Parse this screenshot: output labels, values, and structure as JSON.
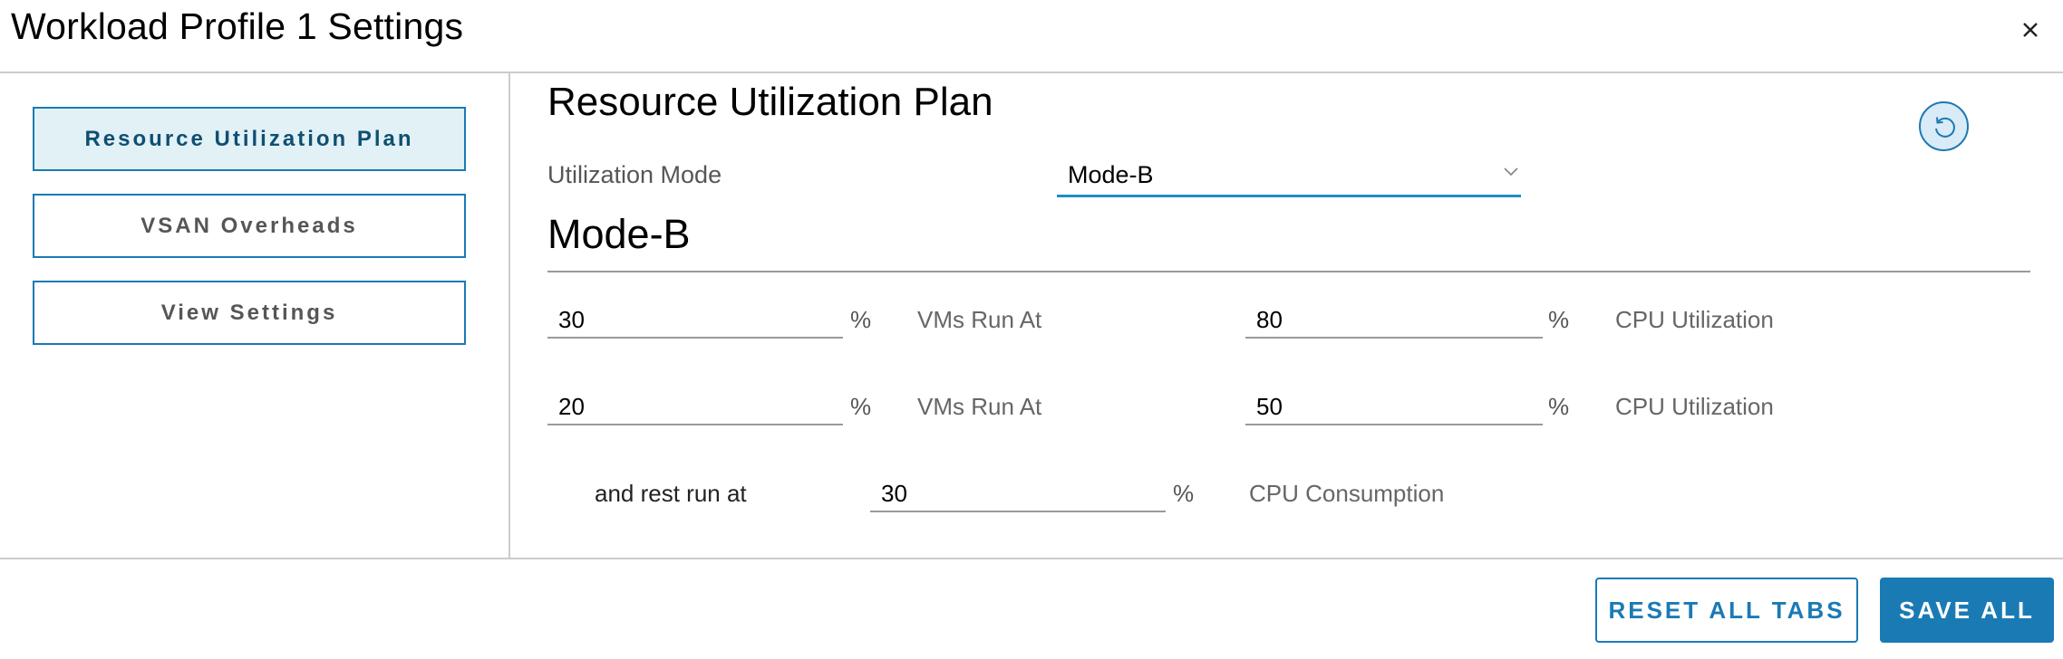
{
  "dialog": {
    "title": "Workload Profile 1 Settings",
    "close_icon": "close-icon"
  },
  "sidebar": {
    "items": [
      {
        "label": "Resource Utilization Plan",
        "active": true
      },
      {
        "label": "VSAN Overheads",
        "active": false
      },
      {
        "label": "View Settings",
        "active": false
      }
    ]
  },
  "main": {
    "title": "Resource Utilization Plan",
    "refresh_icon": "refresh-icon",
    "utilization_mode": {
      "label": "Utilization Mode",
      "selected": "Mode-B"
    },
    "mode_heading": "Mode-B",
    "rows": [
      {
        "vms_percent": "30",
        "percent_sign": "%",
        "vms_label": "VMs Run At",
        "cpu_value": "80",
        "cpu_percent_sign": "%",
        "cpu_label": "CPU Utilization"
      },
      {
        "vms_percent": "20",
        "percent_sign": "%",
        "vms_label": "VMs Run At",
        "cpu_value": "50",
        "cpu_percent_sign": "%",
        "cpu_label": "CPU Utilization"
      }
    ],
    "rest": {
      "label": "and rest run at",
      "value": "30",
      "percent_sign": "%",
      "suffix_label": "CPU Consumption"
    }
  },
  "footer": {
    "reset_label": "RESET ALL TABS",
    "save_label": "SAVE ALL"
  },
  "colors": {
    "accent": "#1b7ab4",
    "active_tab_bg": "#e1f1f6",
    "select_underline": "#1e8dc8"
  }
}
